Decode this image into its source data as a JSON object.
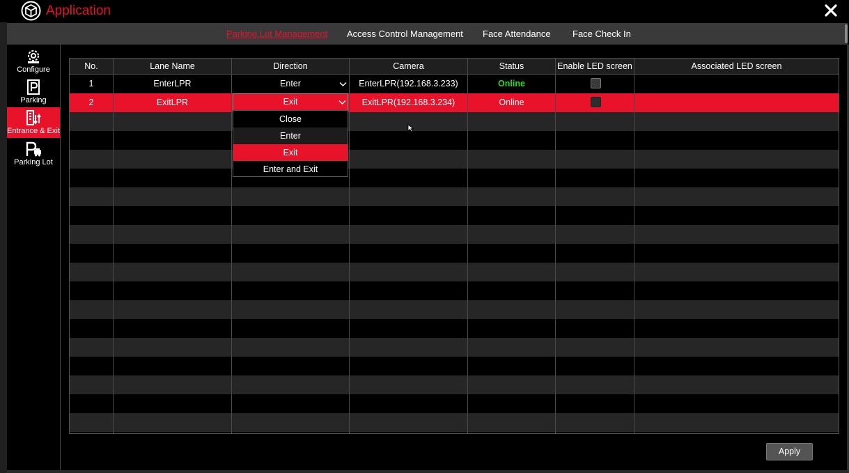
{
  "app": {
    "title": "Application"
  },
  "colors": {
    "accent": "#e8132a",
    "online": "#22dd22"
  },
  "tabs": [
    {
      "label": "Parking Lot Management",
      "active": true
    },
    {
      "label": "Access Control Management",
      "active": false
    },
    {
      "label": "Face Attendance",
      "active": false
    },
    {
      "label": "Face Check In",
      "active": false
    }
  ],
  "sidebar": {
    "items": [
      {
        "label": "Configure",
        "icon": "gear-icon",
        "active": false
      },
      {
        "label": "Parking",
        "icon": "parking-sign-icon",
        "active": false
      },
      {
        "label": "Entrance & Exit",
        "icon": "entrance-exit-icon",
        "active": true
      },
      {
        "label": "Parking Lot",
        "icon": "parking-lot-icon",
        "active": false
      }
    ]
  },
  "table": {
    "columns": [
      "No.",
      "Lane Name",
      "Direction",
      "Camera",
      "Status",
      "Enable LED screen",
      "Associated LED screen"
    ],
    "rows": [
      {
        "no": "1",
        "lane_name": "EnterLPR",
        "direction": "Enter",
        "camera": "EnterLPR(192.168.3.233)",
        "status": "Online",
        "led_enabled": false,
        "associated_led": ""
      },
      {
        "no": "2",
        "lane_name": "ExitLPR",
        "direction": "Exit",
        "camera": "ExitLPR(192.168.3.234)",
        "status": "Online",
        "led_enabled": false,
        "associated_led": ""
      }
    ],
    "selected_row": 2
  },
  "direction_dropdown": {
    "open": true,
    "value": "Exit",
    "options": [
      "Close",
      "Enter",
      "Exit",
      "Enter and Exit"
    ]
  },
  "footer": {
    "apply_label": "Apply"
  }
}
